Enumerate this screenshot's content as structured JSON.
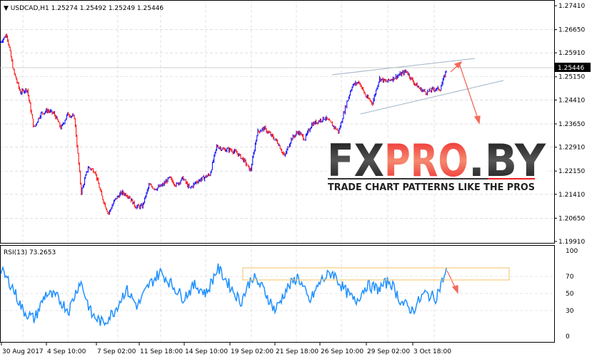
{
  "header": {
    "symbol": "USDCAD,H1",
    "open": "1.25274",
    "high": "1.25492",
    "low": "1.25249",
    "close": "1.25446"
  },
  "rsi_label": "RSI(13) 73.2653",
  "current_price_label": "1.25446",
  "logo": {
    "text": "FXPRO.BY",
    "tagline": "TRADE CHART PATTERNS LIKE THE PROS"
  },
  "colors": {
    "up": "#0000ff",
    "down": "#ff0000",
    "rsi": "#1e90ff",
    "arrow": "#f26b5b",
    "box": "#f5c060",
    "channel": "#a0b4c8"
  },
  "chart_data": [
    {
      "type": "line",
      "title": "USDCAD,H1",
      "ylim": [
        1.1991,
        1.2741
      ],
      "y_ticks": [
        "1.27410",
        "1.26650",
        "1.25910",
        "1.25150",
        "1.24410",
        "1.23650",
        "1.22910",
        "1.22150",
        "1.21410",
        "1.20650",
        "1.19910"
      ],
      "x_ticks": [
        "30 Aug 2017",
        "4 Sep 10:00",
        "7 Sep 02:00",
        "11 Sep 18:00",
        "14 Sep 10:00",
        "19 Sep 02:00",
        "21 Sep 18:00",
        "26 Sep 10:00",
        "29 Sep 02:00",
        "3 Oct 18:00"
      ],
      "values": [
        1.2623,
        1.265,
        1.2533,
        1.2465,
        1.2476,
        1.2351,
        1.2397,
        1.2408,
        1.2397,
        1.2351,
        1.2397,
        1.2385,
        1.2147,
        1.2227,
        1.2215,
        1.2136,
        1.2079,
        1.2125,
        1.2147,
        1.2136,
        1.2102,
        1.2102,
        1.217,
        1.2159,
        1.217,
        1.2193,
        1.217,
        1.2193,
        1.2159,
        1.2181,
        1.2193,
        1.2204,
        1.2295,
        1.2283,
        1.2283,
        1.2272,
        1.2249,
        1.2215,
        1.234,
        1.2351,
        1.2329,
        1.2306,
        1.2261,
        1.2317,
        1.234,
        1.2317,
        1.2363,
        1.2374,
        1.2385,
        1.2363,
        1.234,
        1.2419,
        1.2487,
        1.2499,
        1.2453,
        1.2431,
        1.251,
        1.2499,
        1.251,
        1.2521,
        1.2533,
        1.2499,
        1.2476,
        1.2465,
        1.2476,
        1.2476,
        1.2544
      ]
    },
    {
      "type": "line",
      "title": "RSI(13)",
      "ylim": [
        0,
        100
      ],
      "y_ticks": [
        "100",
        "70",
        "50",
        "30",
        "0"
      ],
      "values": [
        78,
        60,
        30,
        20,
        50,
        45,
        30,
        65,
        25,
        15,
        30,
        55,
        35,
        60,
        75,
        60,
        45,
        60,
        50,
        80,
        60,
        40,
        70,
        55,
        30,
        55,
        70,
        40,
        65,
        75,
        55,
        40,
        60,
        55,
        65,
        40,
        30,
        50,
        45,
        78
      ]
    }
  ]
}
